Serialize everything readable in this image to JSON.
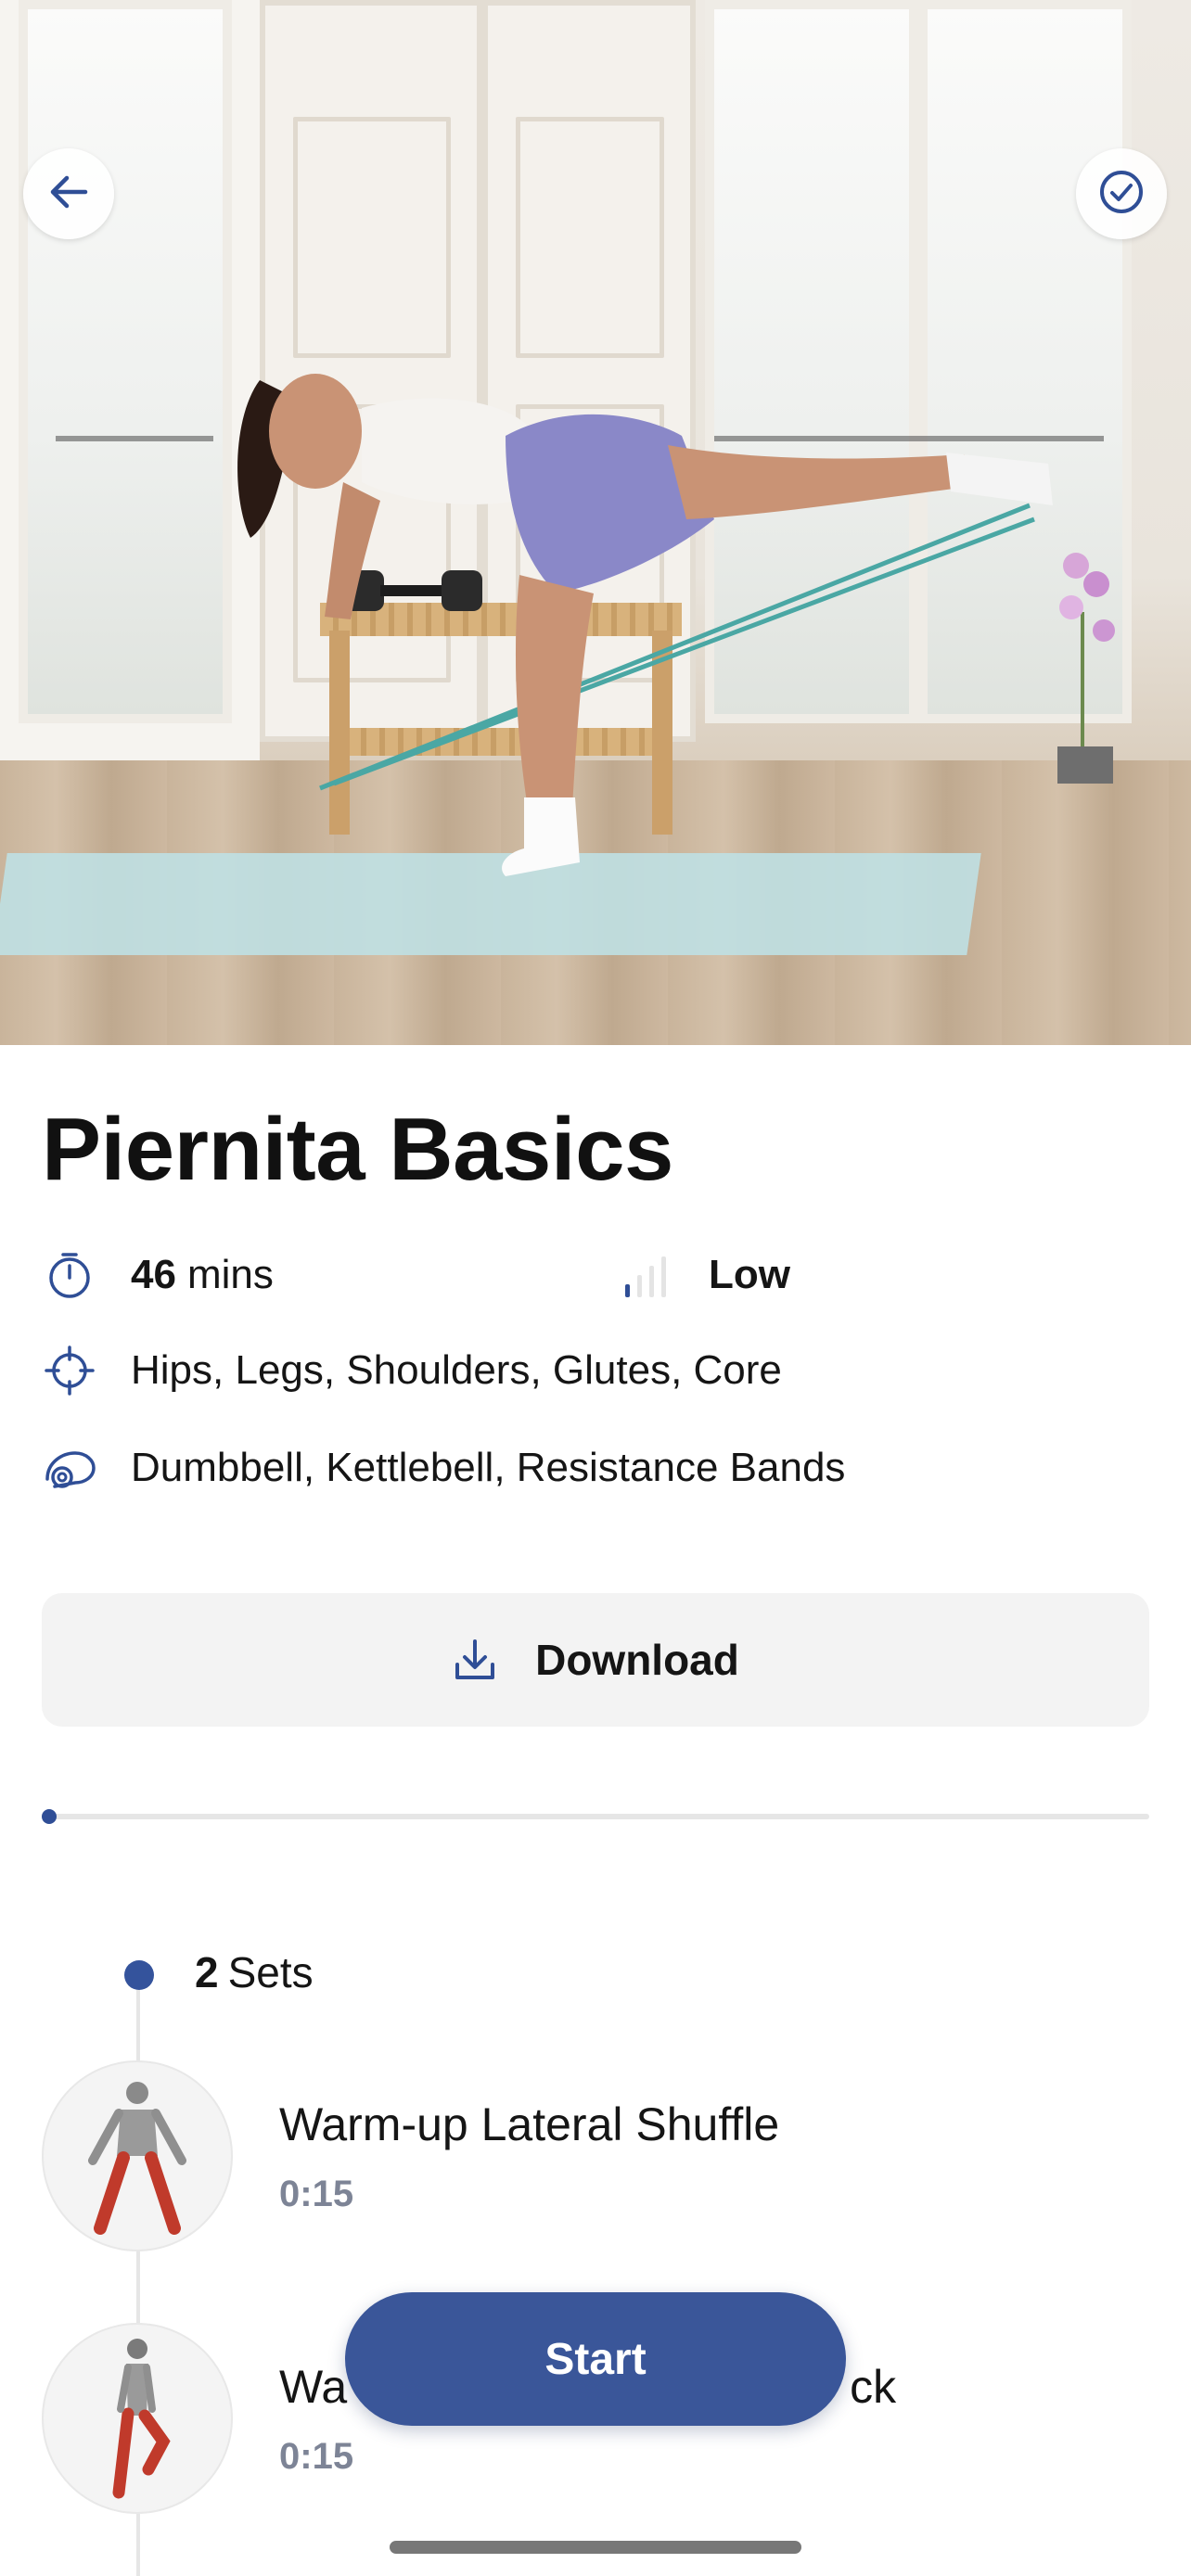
{
  "workout": {
    "title": "Piernita Basics",
    "duration_value": "46",
    "duration_unit": "mins",
    "intensity": "Low",
    "intensity_level": 1,
    "intensity_levels_total": 4,
    "target_areas": "Hips, Legs, Shoulders, Glutes, Core",
    "equipment": "Dumbbell, Kettlebell, Resistance Bands"
  },
  "actions": {
    "download_label": "Download",
    "start_label": "Start"
  },
  "progress": {
    "value": 0
  },
  "sets": {
    "count": "2",
    "label": "Sets"
  },
  "exercises": [
    {
      "name": "Warm-up Lateral Shuffle",
      "duration": "0:15"
    },
    {
      "name": "Wa",
      "name_suffix": "ck",
      "duration": "0:15"
    }
  ],
  "colors": {
    "accent": "#3a5699",
    "accent_dark": "#2f4e96",
    "muted_text": "#7d8496",
    "button_bg": "#f3f3f3"
  },
  "icons": {
    "back": "arrow-left-icon",
    "done": "check-circle-icon",
    "duration": "stopwatch-icon",
    "intensity": "signal-bars-icon",
    "target": "crosshair-icon",
    "equipment": "yoga-mat-icon",
    "download": "download-icon"
  }
}
